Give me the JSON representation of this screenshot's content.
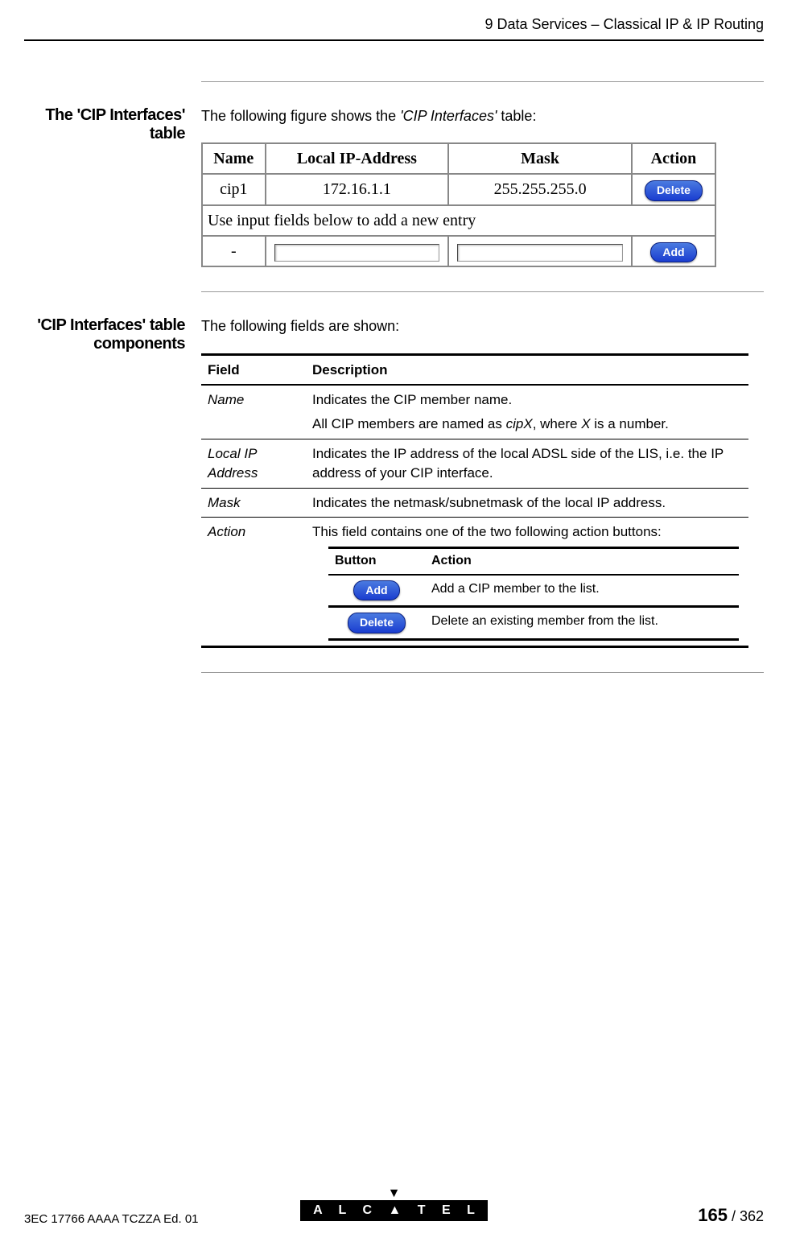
{
  "header": {
    "chapter": "9   Data Services – Classical IP & IP Routing"
  },
  "section1": {
    "label": "The 'CIP Interfaces' table",
    "intro_pre": "The following figure shows the ",
    "intro_em": "'CIP Interfaces'",
    "intro_post": " table:",
    "table": {
      "headers": {
        "name": "Name",
        "ip": "Local IP-Address",
        "mask": "Mask",
        "action": "Action"
      },
      "row": {
        "name": "cip1",
        "ip": "172.16.1.1",
        "mask": "255.255.255.0",
        "btn": "Delete"
      },
      "helper": "Use input fields below to add a new entry",
      "addrow": {
        "name": "-",
        "btn": "Add"
      }
    }
  },
  "section2": {
    "label": "'CIP Interfaces' table components",
    "intro": "The following fields are shown:",
    "fd_headers": {
      "field": "Field",
      "desc": "Description"
    },
    "rows": {
      "name": {
        "field": "Name",
        "d1": "Indicates the CIP member name.",
        "d2a": "All CIP members are named as ",
        "d2b": "cipX",
        "d2c": ", where ",
        "d2d": "X",
        "d2e": " is a number."
      },
      "ip": {
        "field": "Local IP Address",
        "desc": "Indicates the IP address of the local ADSL side of the LIS, i.e. the IP address of your CIP interface."
      },
      "mask": {
        "field": "Mask",
        "desc": "Indicates the netmask/subnetmask of the local IP address."
      },
      "action": {
        "field": "Action",
        "desc": "This field contains one of the two following action buttons:",
        "ba_headers": {
          "button": "Button",
          "action": "Action"
        },
        "add": {
          "btn": "Add",
          "desc": "Add a CIP member to the list."
        },
        "del": {
          "btn": "Delete",
          "desc": "Delete an existing member from the list."
        }
      }
    }
  },
  "footer": {
    "doc": "3EC 17766 AAAA TCZZA Ed. 01",
    "logo": "A L C   T E L",
    "page": "165",
    "total": " / 362"
  }
}
